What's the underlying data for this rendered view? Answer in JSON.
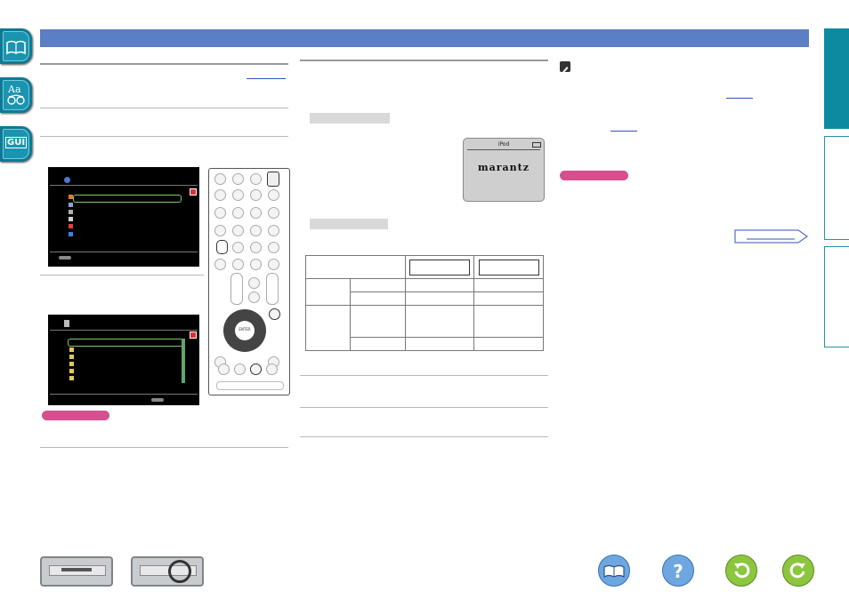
{
  "side_tabs_left": [
    {
      "icon": "book-icon",
      "label": ""
    },
    {
      "icon": "glossary-icon",
      "label": "Aa"
    },
    {
      "icon": "gui-icon",
      "label": "GUI"
    }
  ],
  "side_tabs_right": [
    {
      "label": ""
    },
    {
      "label": ""
    },
    {
      "label": ""
    }
  ],
  "display": {
    "title": "iPod",
    "brand": "marantz"
  },
  "remote": {
    "enter_label": "ENTER",
    "search_label": "SEARCH"
  },
  "colors": {
    "header": "#5b7fc4",
    "tab": "#0d7a93",
    "note": "#d64f8f"
  },
  "bottom_icons": [
    "contents-icon",
    "help-icon",
    "back-icon",
    "forward-icon"
  ]
}
